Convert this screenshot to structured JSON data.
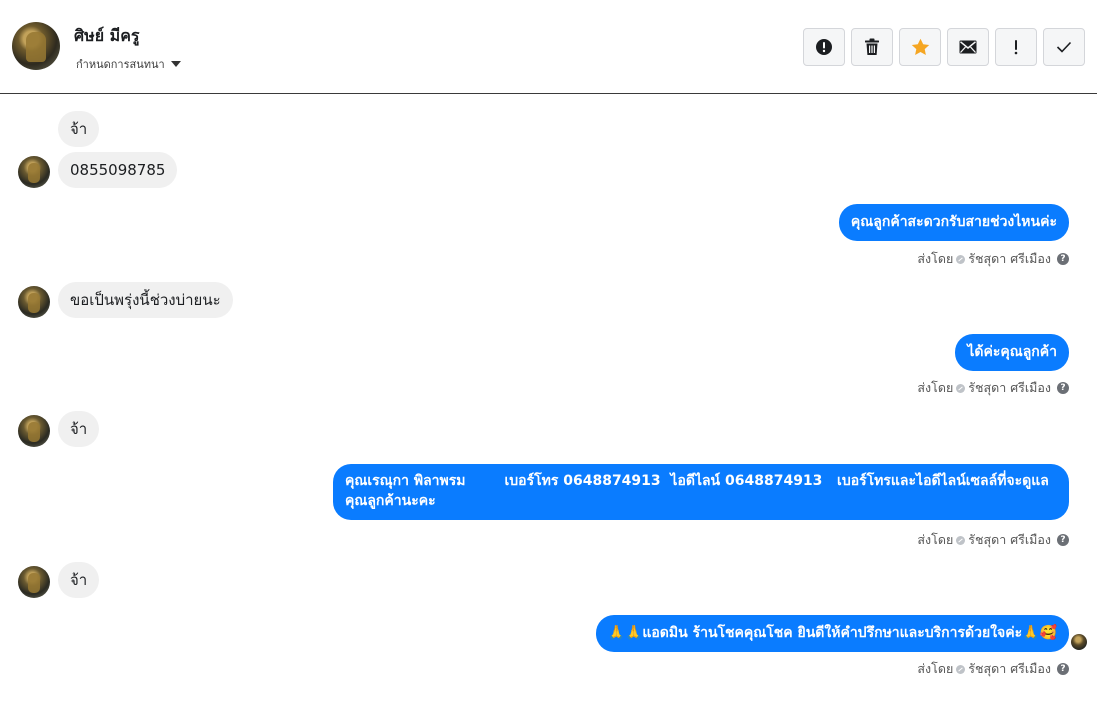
{
  "header": {
    "contact_name": "ศิษย์ มีครู",
    "assign_label": "กำหนดการสนทนา",
    "toolbar": [
      {
        "name": "spam-button",
        "icon": "alert-circle-icon"
      },
      {
        "name": "delete-button",
        "icon": "trash-icon"
      },
      {
        "name": "star-button",
        "icon": "star-icon"
      },
      {
        "name": "mail-button",
        "icon": "envelope-icon"
      },
      {
        "name": "follow-up-button",
        "icon": "exclamation-icon"
      },
      {
        "name": "done-button",
        "icon": "checkmark-icon"
      }
    ],
    "colors": {
      "star": "#f5a623",
      "border": "#d4d6da"
    }
  },
  "messages": [
    {
      "direction": "in",
      "text": "จ้า"
    },
    {
      "direction": "in",
      "text": "0855098785"
    },
    {
      "direction": "out",
      "text": "คุณลูกค้าสะดวกรับสายช่วงไหนค่ะ",
      "sent_by_label": "ส่งโดย",
      "sender": "รัชสุดา ศรีเมือง"
    },
    {
      "direction": "in",
      "text": "ขอเป็นพรุ่งนี้ช่วงบ่ายนะ"
    },
    {
      "direction": "out",
      "text": "ได้ค่ะคุณลูกค้า",
      "sent_by_label": "ส่งโดย",
      "sender": "รัชสุดา ศรีเมือง"
    },
    {
      "direction": "in",
      "text": "จ้า"
    },
    {
      "direction": "out",
      "text_line1": "คุณเรณุกา พิลาพรม        เบอร์โทร 0648874913  ไอดีไลน์ 0648874913   เบอร์โทรและไอดีไลน์เซลล์ที่จะดูแล",
      "text_line2": "คุณลูกค้านะคะ",
      "sent_by_label": "ส่งโดย",
      "sender": "รัชสุดา ศรีเมือง"
    },
    {
      "direction": "in",
      "text": "จ้า"
    },
    {
      "direction": "out",
      "text": "🙏🙏แอดมิน ร้านโชคคุณโชค ยินดีให้คำปรึกษาและบริการด้วยใจค่ะ🙏🥰",
      "sent_by_label": "ส่งโดย",
      "sender": "รัชสุดา ศรีเมือง"
    }
  ],
  "colors": {
    "outgoing_bubble": "#0a7cff",
    "incoming_bubble": "#f0f0f0"
  }
}
